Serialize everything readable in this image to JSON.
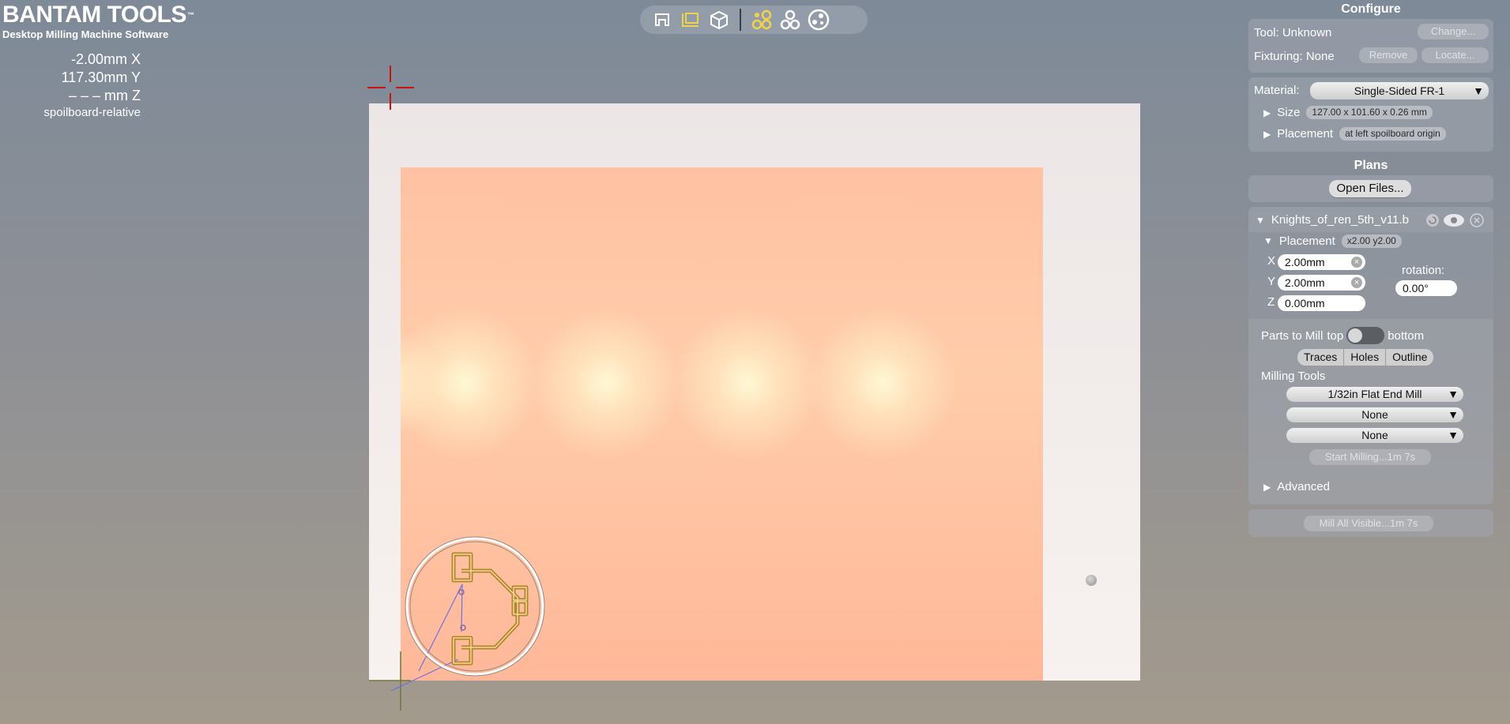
{
  "logo": {
    "title": "BANTAM TOOLS",
    "trademark": "™",
    "subtitle": "Desktop Milling Machine Software"
  },
  "dro": {
    "x": "-2.00mm X",
    "y": "117.30mm Y",
    "z": "– – – mm Z",
    "mode": "spoilboard-relative"
  },
  "toolbar": {
    "view_icons": [
      "top-view-icon",
      "front-view-icon",
      "iso-view-icon"
    ],
    "mode_icons": [
      "traces-view-icon",
      "outline-view-icon",
      "tool-paths-icon"
    ]
  },
  "configure": {
    "title": "Configure",
    "tool_label": "Tool: Unknown",
    "change_button": "Change...",
    "fixturing_label": "Fixturing: None",
    "remove_button": "Remove",
    "locate_button": "Locate...",
    "material_label": "Material:",
    "material_value": "Single-Sided FR-1",
    "size_label": "Size",
    "size_value": "127.00 x 101.60 x 0.26 mm",
    "placement_label": "Placement",
    "placement_value": "at left spoilboard origin"
  },
  "plans": {
    "title": "Plans",
    "open_files_button": "Open Files...",
    "file_name": "Knights_of_ren_5th_v11.b",
    "placement_label": "Placement",
    "placement_value": "x2.00 y2.00",
    "x_label": "X",
    "x_value": "2.00mm",
    "y_label": "Y",
    "y_value": "2.00mm",
    "z_label": "Z",
    "z_value": "0.00mm",
    "rotation_label": "rotation:",
    "rotation_value": "0.00°",
    "parts_to_mill_label": "Parts to Mill",
    "top_label": "top",
    "bottom_label": "bottom",
    "segments": [
      "Traces",
      "Holes",
      "Outline"
    ],
    "milling_tools_label": "Milling Tools",
    "tool_1": "1/32in Flat End Mill",
    "tool_2": "None",
    "tool_3": "None",
    "start_milling_button": "Start Milling...1m 7s",
    "advanced_label": "Advanced",
    "mill_all_button": "Mill All Visible...1m 7s"
  },
  "colors": {
    "board": "#ffc2a3",
    "trace": "#b5852c",
    "crosshair": "#cc1111",
    "panel": "#a0a6ae"
  }
}
